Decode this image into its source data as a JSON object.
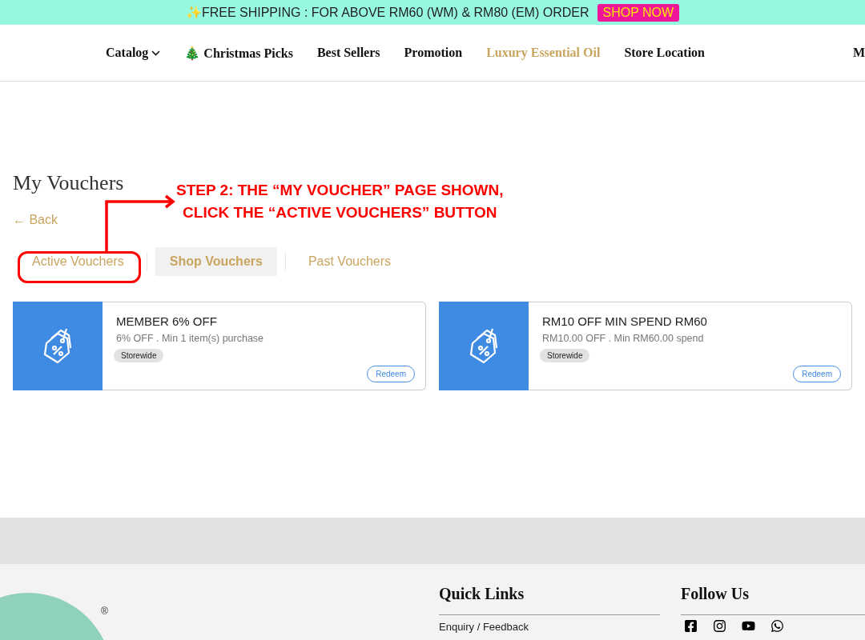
{
  "announcement": {
    "text": "✨FREE SHIPPING : FOR ABOVE RM60 (WM) & RM80 (EM) ORDER",
    "button": "SHOP NOW"
  },
  "nav": [
    {
      "label": "Catalog",
      "kind": "dropdown",
      "highlighted": false
    },
    {
      "label": "🎄 Christmas Picks",
      "kind": "link",
      "highlighted": false
    },
    {
      "label": "Best Sellers",
      "kind": "link",
      "highlighted": false
    },
    {
      "label": "Promotion",
      "kind": "link",
      "highlighted": false
    },
    {
      "label": "Luxury Essential Oil",
      "kind": "link",
      "highlighted": true
    },
    {
      "label": "Store Location",
      "kind": "link",
      "highlighted": false
    }
  ],
  "nav_right": "M",
  "page": {
    "title": "My Vouchers",
    "back": "← Back"
  },
  "tabs": [
    {
      "label": "Active Vouchers",
      "selected": false
    },
    {
      "label": "Shop Vouchers",
      "selected": true
    },
    {
      "label": "Past Vouchers",
      "selected": false
    }
  ],
  "vouchers": [
    {
      "title": "MEMBER 6% OFF",
      "detail": "6% OFF . Min 1 item(s) purchase",
      "tag": "Storewide",
      "button": "Redeem"
    },
    {
      "title": "RM10 OFF MIN SPEND RM60",
      "detail": "RM10.00 OFF . Min RM60.00 spend",
      "tag": "Storewide",
      "button": "Redeem"
    }
  ],
  "annotation": {
    "lines": [
      "STEP 2: THE “MY VOUCHER” PAGE SHOWN,",
      "CLICK THE “ACTIVE VOUCHERS” BUTTON"
    ]
  },
  "footer": {
    "logo_mark": "®",
    "quick_links": {
      "heading": "Quick Links",
      "items": [
        "Enquiry / Feedback"
      ]
    },
    "follow": {
      "heading": "Follow Us"
    }
  }
}
